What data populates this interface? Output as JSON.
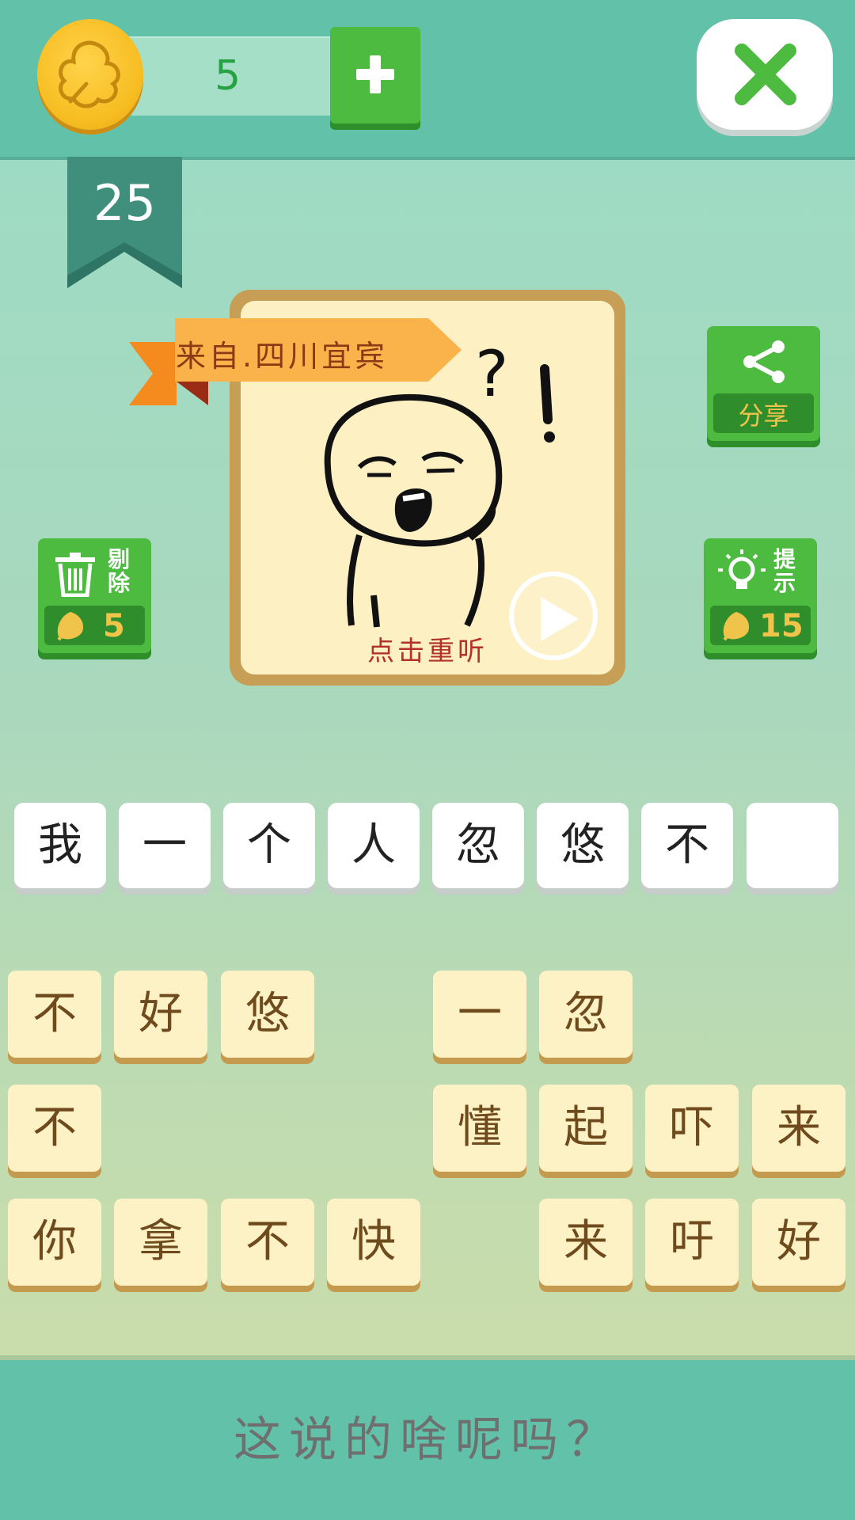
{
  "header": {
    "coin_count": "5",
    "level": "25",
    "icons": {
      "coin": "leaf-coin-icon",
      "add": "plus-icon",
      "close": "close-x-icon"
    }
  },
  "puzzle": {
    "origin_label": "来自.四川宜宾",
    "replay_label": "点击重听",
    "icons": {
      "play": "play-icon",
      "character": "confused-face-illustration"
    }
  },
  "actions": {
    "share_label": "分享",
    "remove_label": "剔除",
    "remove_cost": "5",
    "hint_label": "提示",
    "hint_cost": "15"
  },
  "answer_slots": [
    "我",
    "一",
    "个",
    "人",
    "忽",
    "悠",
    "不",
    ""
  ],
  "tiles": [
    [
      "不",
      "好",
      "悠",
      "",
      "一",
      "忽",
      "",
      ""
    ],
    [
      "不",
      "",
      "",
      "",
      "懂",
      "起",
      "吓",
      "来"
    ],
    [
      "你",
      "拿",
      "不",
      "快",
      "",
      "来",
      "吁",
      "好"
    ]
  ],
  "footer": {
    "question": "这说的啥呢吗？"
  },
  "colors": {
    "teal": "#62c2a9",
    "green": "#4cbb3f",
    "coin": "#f7bd22",
    "card": "#fdf0c2"
  }
}
